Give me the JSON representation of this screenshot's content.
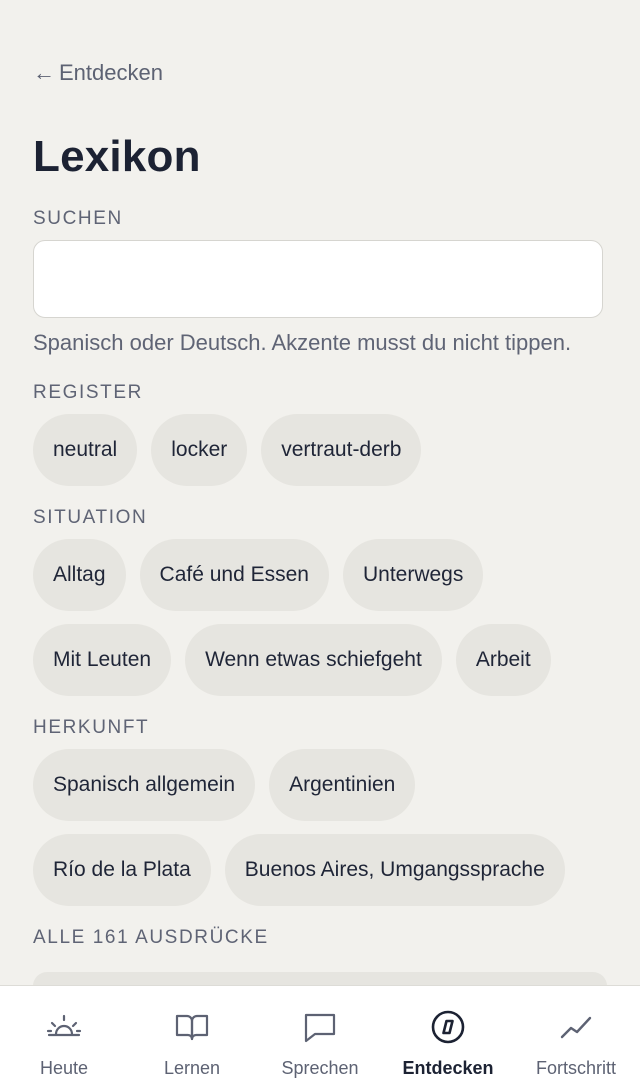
{
  "header": {
    "back_arrow": "←",
    "back_label": "Entdecken",
    "title": "Lexikon"
  },
  "search": {
    "label": "SUCHEN",
    "value": "",
    "placeholder": "",
    "hint": "Spanisch oder Deutsch. Akzente musst du nicht tippen."
  },
  "filters": {
    "register": {
      "label": "REGISTER",
      "chips": [
        "neutral",
        "locker",
        "vertraut-derb"
      ]
    },
    "situation": {
      "label": "SITUATION",
      "chips": [
        "Alltag",
        "Café und Essen",
        "Unterwegs",
        "Mit Leuten",
        "Wenn etwas schiefgeht",
        "Arbeit"
      ]
    },
    "herkunft": {
      "label": "HERKUNFT",
      "chips": [
        "Spanisch allgemein",
        "Argentinien",
        "Río de la Plata",
        "Buenos Aires, Umgangssprache"
      ]
    }
  },
  "list": {
    "heading": "ALLE 161 AUSDRÜCKE"
  },
  "tabbar": {
    "tabs": [
      {
        "label": "Heute",
        "icon": "sunrise-icon"
      },
      {
        "label": "Lernen",
        "icon": "book-icon"
      },
      {
        "label": "Sprechen",
        "icon": "speech-bubble-icon"
      },
      {
        "label": "Entdecken",
        "icon": "compass-icon",
        "active": true
      },
      {
        "label": "Fortschritt",
        "icon": "trend-line-icon"
      }
    ]
  },
  "colors": {
    "background": "#f2f1ed",
    "chip": "#e6e5e0",
    "text": "#1f2537",
    "muted": "#5f6475"
  }
}
